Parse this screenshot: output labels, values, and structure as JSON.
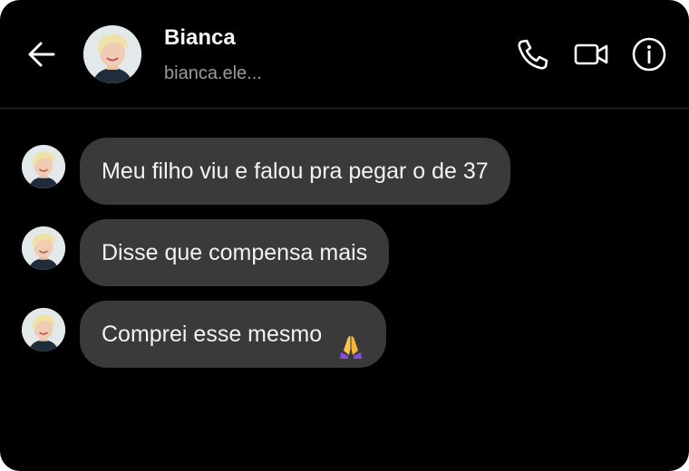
{
  "header": {
    "name": "Bianca",
    "handle": "bianca.ele...",
    "icons": [
      "back-arrow-icon",
      "phone-icon",
      "video-camera-icon",
      "info-icon"
    ]
  },
  "messages": [
    {
      "text": "Meu filho viu e falou pra pegar o de 37"
    },
    {
      "text": "Disse que compensa mais"
    },
    {
      "text": "Comprei esse mesmo",
      "emoji": "folded-hands"
    }
  ],
  "colors": {
    "background": "#000000",
    "bubble": "#3a3a3a",
    "text": "#f2f2f2",
    "secondary_text": "#9a9a9a",
    "emoji_sleeve": "#8a4be0",
    "emoji_hand": "#f7c64a"
  }
}
